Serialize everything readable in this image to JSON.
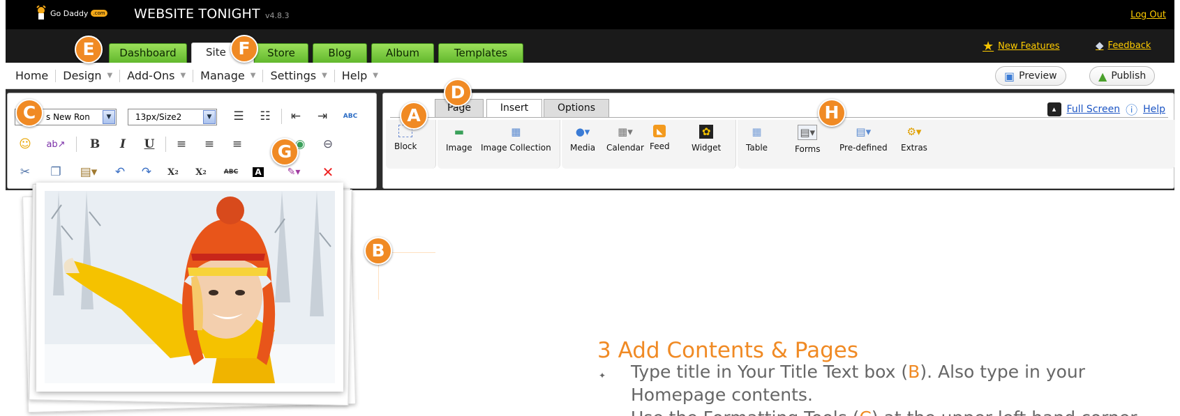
{
  "app": {
    "logo_text": "Go Daddy",
    "logo_badge": ".com",
    "title": "WEBSITE TONIGHT",
    "version": "v4.8.3",
    "logout": "Log Out"
  },
  "tabs": [
    {
      "label": "Dashboard"
    },
    {
      "label": "Site"
    },
    {
      "label": "Store"
    },
    {
      "label": "Blog"
    },
    {
      "label": "Album"
    },
    {
      "label": "Templates"
    }
  ],
  "header_links": {
    "new_features": "New Features",
    "feedback": "Feedback"
  },
  "menu": {
    "items": [
      {
        "label": "Home"
      },
      {
        "label": "Design"
      },
      {
        "label": "Add-Ons"
      },
      {
        "label": "Manage"
      },
      {
        "label": "Settings"
      },
      {
        "label": "Help"
      }
    ],
    "preview": "Preview",
    "publish": "Publish"
  },
  "format_toolbar": {
    "font_value": "s New Ron",
    "size_value": "13px/Size2",
    "bold": "B",
    "italic": "I",
    "underline": "U",
    "subscript": "X",
    "superscript": "X",
    "strike": "ABC",
    "font_color": "A",
    "spellcheck": "ABC"
  },
  "insert_panel": {
    "tabs": [
      "Page",
      "Insert",
      "Options"
    ],
    "full_screen": "Full Screen",
    "help": "Help",
    "buttons": [
      {
        "label": "Block"
      },
      {
        "label": "Image"
      },
      {
        "label": "Image Collection"
      },
      {
        "label": "Media"
      },
      {
        "label": "Calendar"
      },
      {
        "label": "Feed"
      },
      {
        "label": "Widget"
      },
      {
        "label": "Table"
      },
      {
        "label": "Forms"
      },
      {
        "label": "Pre-defined"
      },
      {
        "label": "Extras"
      }
    ]
  },
  "markers": {
    "a": "A",
    "b": "B",
    "c": "C",
    "d": "D",
    "e": "E",
    "f": "F",
    "g": "G",
    "h": "H"
  },
  "instructions": {
    "title": "3 Add Contents & Pages",
    "line1_pre": "Type title in Your Title Text box (",
    "line1_hl": "B",
    "line1_post": "). Also type in your",
    "line2": "Homepage contents.",
    "line3_pre": "Use the Formatting Tools (",
    "line3_hl": "C",
    "line3_post": ") at the upper left hand corner"
  },
  "colors": {
    "accent": "#f08a24",
    "tab_green": "#62b82d",
    "link_yellow": "#ffcc00",
    "link_blue": "#1c55c4"
  }
}
